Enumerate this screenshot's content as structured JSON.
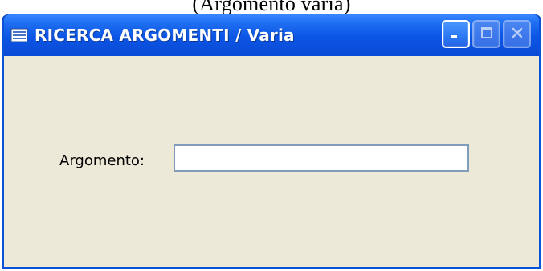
{
  "top_caption": "(Argomento varia)",
  "window": {
    "title": "RICERCA ARGOMENTI / Varia",
    "icon": "window-app-icon",
    "controls": {
      "minimize_icon": "minimize-icon",
      "maximize_icon": "maximize-icon",
      "close_icon": "close-icon"
    },
    "colors": {
      "titlebar": "#0a4bd6",
      "client_bg": "#ece9d8"
    }
  },
  "form": {
    "argomento": {
      "label": "Argomento:",
      "value": "",
      "placeholder": ""
    }
  }
}
